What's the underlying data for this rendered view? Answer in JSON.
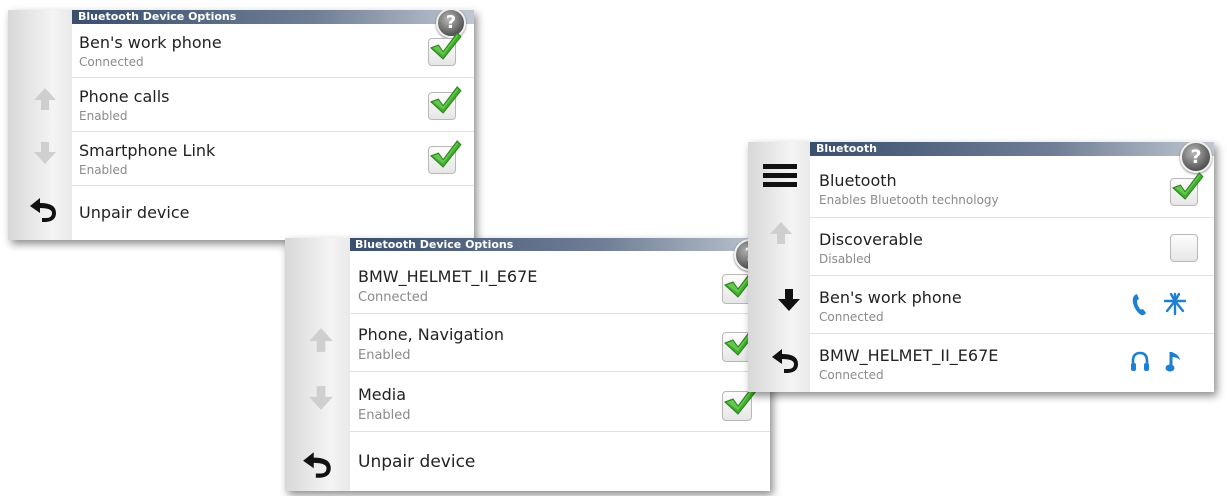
{
  "screen1": {
    "title": "Bluetooth Device Options",
    "help": "?",
    "items": [
      {
        "label": "Ben's work phone",
        "sub": "Connected",
        "checked": true
      },
      {
        "label": "Phone calls",
        "sub": "Enabled",
        "checked": true
      },
      {
        "label": "Smartphone Link",
        "sub": "Enabled",
        "checked": true
      },
      {
        "label": "Unpair device"
      }
    ],
    "side_icons": [
      "up-arrow-icon",
      "down-arrow-icon",
      "back-icon"
    ]
  },
  "screen2": {
    "title": "Bluetooth Device Options",
    "help": "?",
    "items": [
      {
        "label": "BMW_HELMET_II_E67E",
        "sub": "Connected",
        "checked": true
      },
      {
        "label": "Phone, Navigation",
        "sub": "Enabled",
        "checked": true
      },
      {
        "label": "Media",
        "sub": "Enabled",
        "checked": true
      },
      {
        "label": "Unpair device"
      }
    ],
    "side_icons": [
      "up-arrow-icon",
      "down-arrow-icon",
      "back-icon"
    ]
  },
  "screen3": {
    "title": "Bluetooth",
    "help": "?",
    "items": [
      {
        "label": "Bluetooth",
        "sub": "Enables Bluetooth technology",
        "checked": true
      },
      {
        "label": "Discoverable",
        "sub": "Disabled",
        "checked": false
      },
      {
        "label": "Ben's work phone",
        "sub": "Connected",
        "icons": [
          "phone-icon",
          "smartphone-link-icon"
        ]
      },
      {
        "label": "BMW_HELMET_II_E67E",
        "sub": "Connected",
        "icons": [
          "headset-icon",
          "music-note-icon"
        ]
      }
    ],
    "side_icons": [
      "menu-icon",
      "up-arrow-icon",
      "down-arrow-icon",
      "back-icon"
    ]
  },
  "colors": {
    "check_green": "#3fae2a",
    "icon_blue": "#1f7fd1",
    "titlebar": "#3a4f6e"
  }
}
